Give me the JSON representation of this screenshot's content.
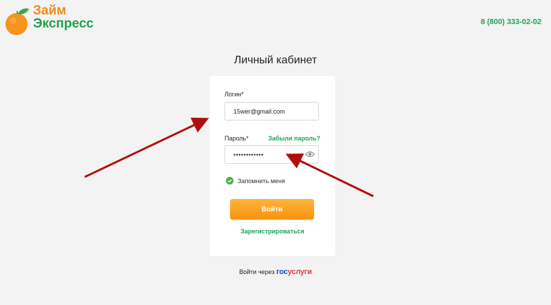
{
  "header": {
    "logo": {
      "line1": "Займ",
      "line2": "Экспресс"
    },
    "phone": "8 (800) 333-02-02"
  },
  "page_title": "Личный кабинет",
  "form": {
    "login_label": "Логин*",
    "login_value": "15wer@gmail.com",
    "password_label": "Пароль*",
    "forgot_label": "Забыли пароль?",
    "password_value": "••••••••••••",
    "remember_label": "Запомнить меня",
    "submit_label": "Войти",
    "register_label": "Зарегистрироваться"
  },
  "alt_login": {
    "prefix": "Войти через",
    "brand_part1": "гос",
    "brand_part2": "услуги"
  },
  "icons": {
    "logo": "orange-fruit-icon",
    "password_toggle": "eye-icon",
    "remember": "checkmark-circle-icon"
  },
  "colors": {
    "brand_green": "#1ca257",
    "brand_orange": "#f7920e",
    "annotation_arrow": "#b30d0d",
    "gosuslugi_blue": "#0d4cd3",
    "gosuslugi_red": "#e63b43"
  }
}
